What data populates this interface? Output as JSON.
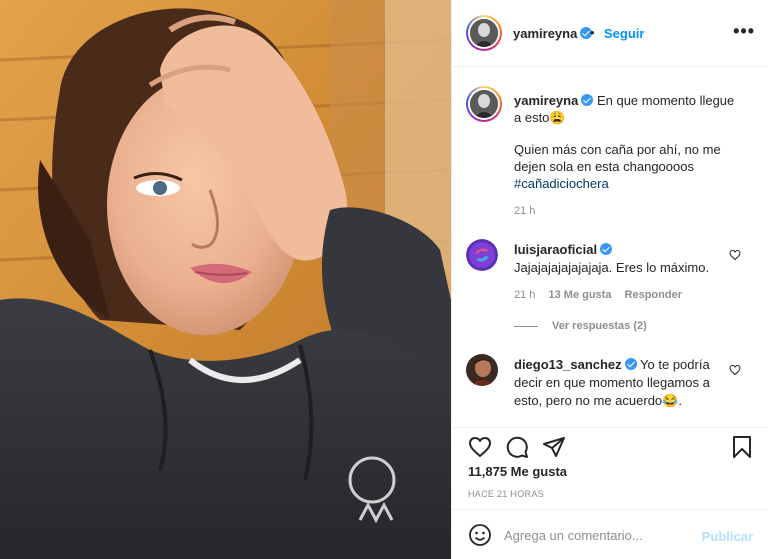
{
  "post": {
    "username": "yamireyna",
    "follow_label": "Seguir",
    "dot": "•",
    "more_label": "•••"
  },
  "caption": {
    "username": "yamireyna",
    "line1": "En que momento llegue a esto😩",
    "line2": "Quien más con caña por ahí, no me dejen sola en esta changoooos",
    "hashtag": "#cañadiciochera",
    "time": "21 h"
  },
  "comments": [
    {
      "username": "luisjaraoficial",
      "text": "Jajajajajajajajaja. Eres lo máximo.",
      "time": "21 h",
      "likes": "13 Me gusta",
      "reply_label": "Responder",
      "view_replies": "Ver respuestas (2)"
    },
    {
      "username": "diego13_sanchez",
      "text": "Yo te podría decir en que momento llegamos a esto, pero no me acuerdo😂."
    }
  ],
  "likes_count": "11,875 Me gusta",
  "time_ago": "HACE 21 HORAS",
  "add_comment": {
    "placeholder": "Agrega un comentario...",
    "publish_label": "Publicar"
  },
  "icons": [
    "heart-icon",
    "comment-icon",
    "share-icon",
    "bookmark-icon",
    "emoji-icon",
    "more-icon",
    "verified-icon"
  ],
  "colors": {
    "accent": "#0095f6",
    "verified": "#3897f0",
    "hashtag": "#00376b",
    "muted": "#8e8e8e",
    "publish_disabled": "#b2dffc"
  }
}
